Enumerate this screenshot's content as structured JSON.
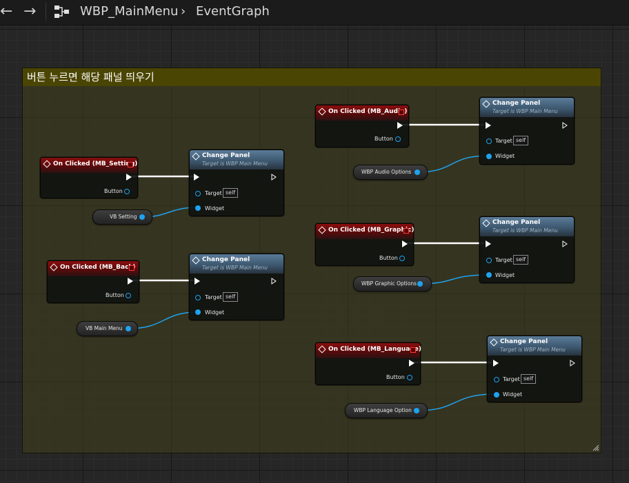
{
  "toolbar": {
    "back_icon": "back-arrow-icon",
    "forward_icon": "forward-arrow-icon",
    "blueprint_icon": "blueprint-graph-icon",
    "asset_name": "WBP_MainMenu",
    "graph_name": "EventGraph"
  },
  "comment": {
    "title": "버튼 누르면 해당 패널 띄우기"
  },
  "labels": {
    "button_pin": "Button",
    "target_pin": "Target",
    "widget_pin": "Widget",
    "self_value": "self",
    "function_title": "Change Panel",
    "function_subtitle": "Target is WBP Main Menu"
  },
  "events": {
    "setting": "On Clicked (MB_Setting)",
    "back": "On Clicked (MB_Back)",
    "audio": "On Clicked (MB_Audio)",
    "graphic": "On Clicked (MB_Graphic)",
    "language": "On Clicked (MB_Language)"
  },
  "getters": {
    "setting": "VB Setting",
    "back": "VB Main Menu",
    "audio": "WBP Audio Options",
    "graphic": "WBP Graphic Options",
    "language": "WBP Language Option"
  },
  "colors": {
    "exec_wire": "#ffffff",
    "object_wire": "#1ea3ef",
    "event_header": "#8a0e0e",
    "function_header": "#5b7b98",
    "comment_header": "#4b4503"
  }
}
